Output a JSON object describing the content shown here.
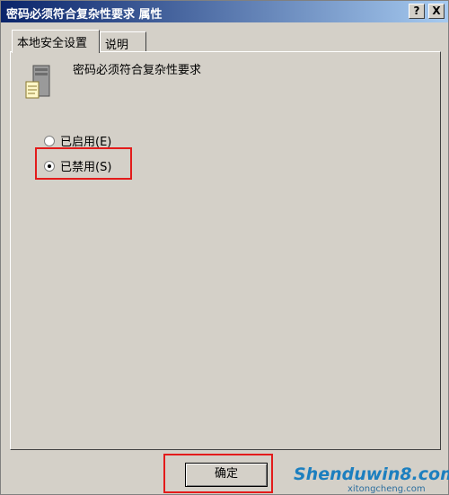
{
  "window": {
    "title": "密码必须符合复杂性要求 属性",
    "help_button": "?",
    "close_button": "X"
  },
  "tabs": [
    {
      "label": "本地安全设置",
      "active": true
    },
    {
      "label": "说明",
      "active": false
    }
  ],
  "policy": {
    "icon": "server-policy-icon",
    "title": "密码必须符合复杂性要求"
  },
  "options": [
    {
      "label": "已启用(E)",
      "checked": false
    },
    {
      "label": "已禁用(S)",
      "checked": true
    }
  ],
  "buttons": {
    "ok_label": "确定"
  },
  "watermark": {
    "main": "Shenduwin8.com",
    "sub": "xitongcheng.com"
  },
  "colors": {
    "title_start": "#0a246a",
    "title_end": "#a6caf0",
    "highlight": "#e31b1b",
    "face": "#d4d0c8"
  }
}
